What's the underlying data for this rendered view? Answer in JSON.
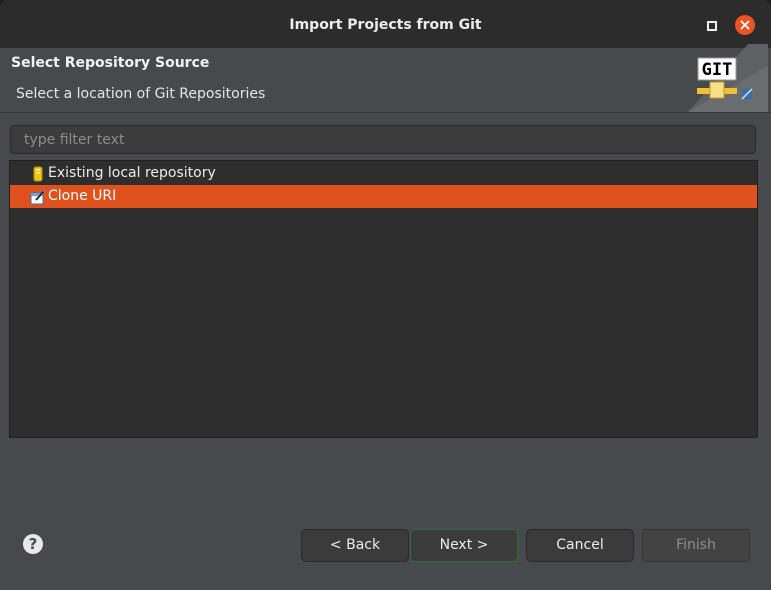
{
  "window": {
    "title": "Import Projects from Git"
  },
  "header": {
    "title": "Select Repository Source",
    "description": "Select a location of Git Repositories",
    "banner_icon": "git-banner-icon",
    "banner_text": "GIT"
  },
  "filter": {
    "placeholder": "type filter text",
    "value": ""
  },
  "tree": {
    "items": [
      {
        "label": "Existing local repository",
        "icon": "repository-icon",
        "selected": false
      },
      {
        "label": "Clone URI",
        "icon": "clone-uri-icon",
        "selected": true
      }
    ]
  },
  "footer": {
    "help_icon": "?",
    "back_label": "< Back",
    "next_label": "Next >",
    "cancel_label": "Cancel",
    "finish_label": "Finish"
  },
  "colors": {
    "accent": "#e95420",
    "selection": "#e0521d",
    "window_bg": "#474a4c",
    "titlebar_bg": "#2c2c2c"
  }
}
